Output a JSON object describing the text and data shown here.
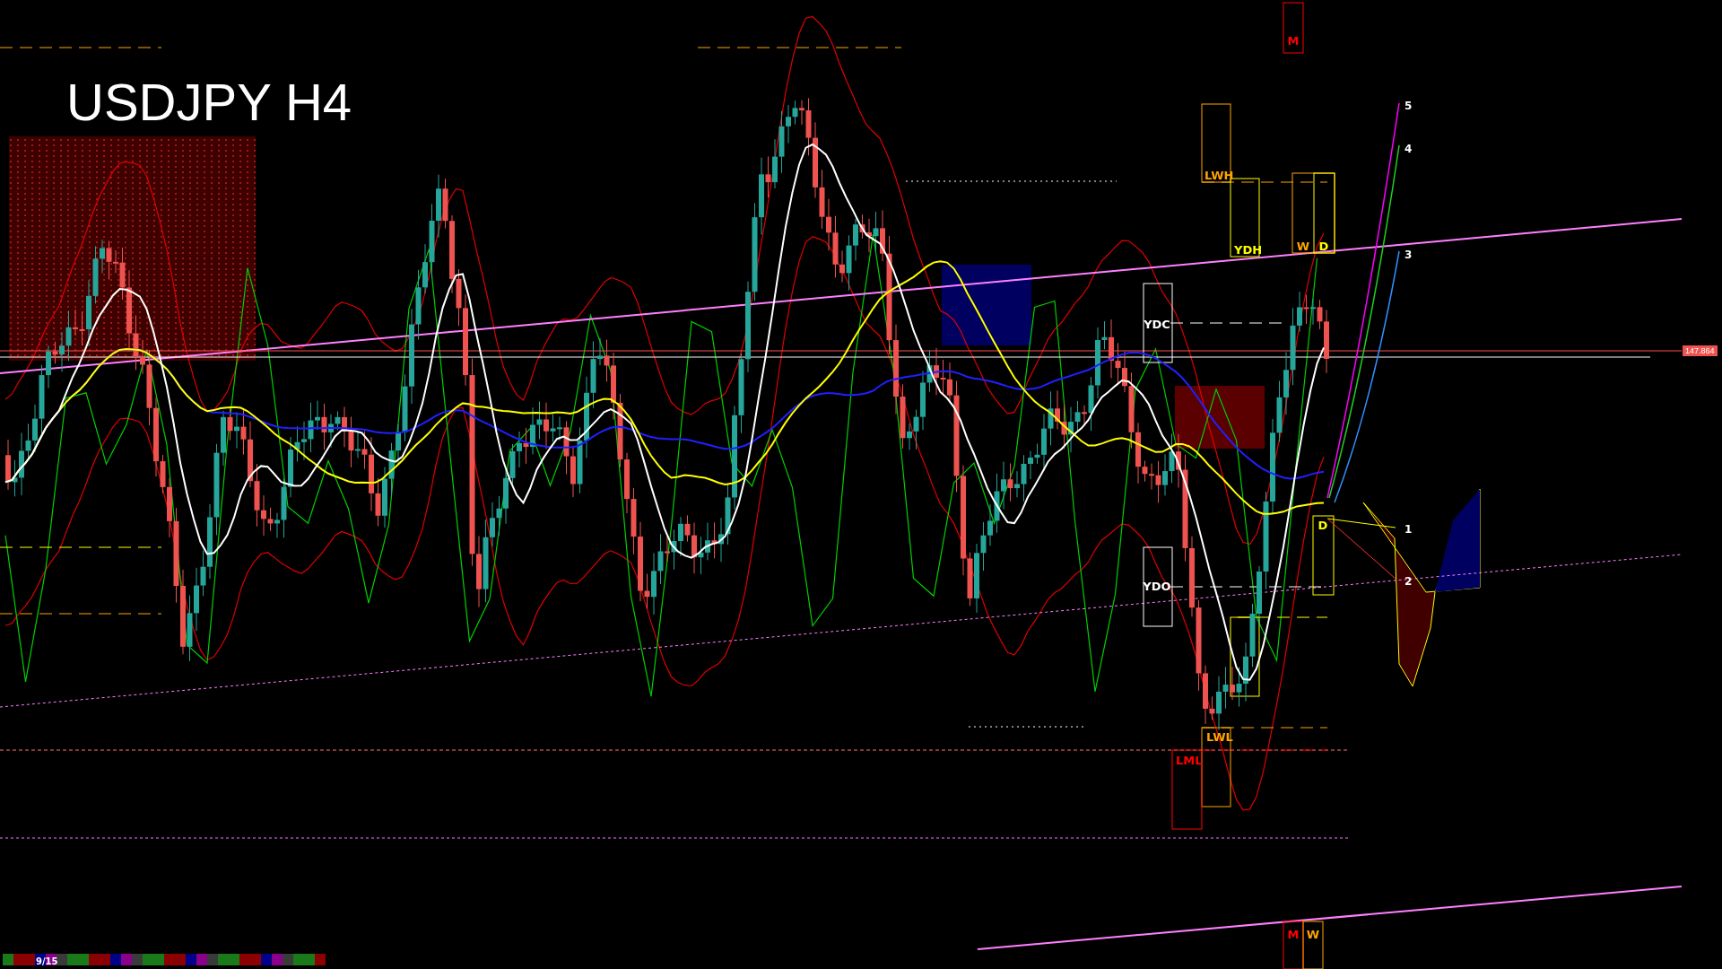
{
  "chart": {
    "title": "USDJPY H4",
    "price_label": "147.864",
    "level_labels": [
      {
        "text": "M",
        "color": "#ff0000"
      },
      {
        "text": "LWH",
        "color": "#ffa500"
      },
      {
        "text": "YDH",
        "color": "#ffff00"
      },
      {
        "text": "W",
        "color": "#ffa500"
      },
      {
        "text": "D",
        "color": "#ffff00"
      },
      {
        "text": "YDC",
        "color": "#ffffff"
      },
      {
        "text": "D",
        "color": "#ffff00"
      },
      {
        "text": "YDO",
        "color": "#ffffff"
      },
      {
        "text": "LWL",
        "color": "#ffa500"
      },
      {
        "text": "LML",
        "color": "#ff0000"
      },
      {
        "text": "M",
        "color": "#ff0000"
      },
      {
        "text": "W",
        "color": "#ffa500"
      }
    ],
    "target_labels": [
      "5",
      "4",
      "3",
      "1",
      "2"
    ]
  },
  "status_strip": {
    "page": "9/15"
  }
}
